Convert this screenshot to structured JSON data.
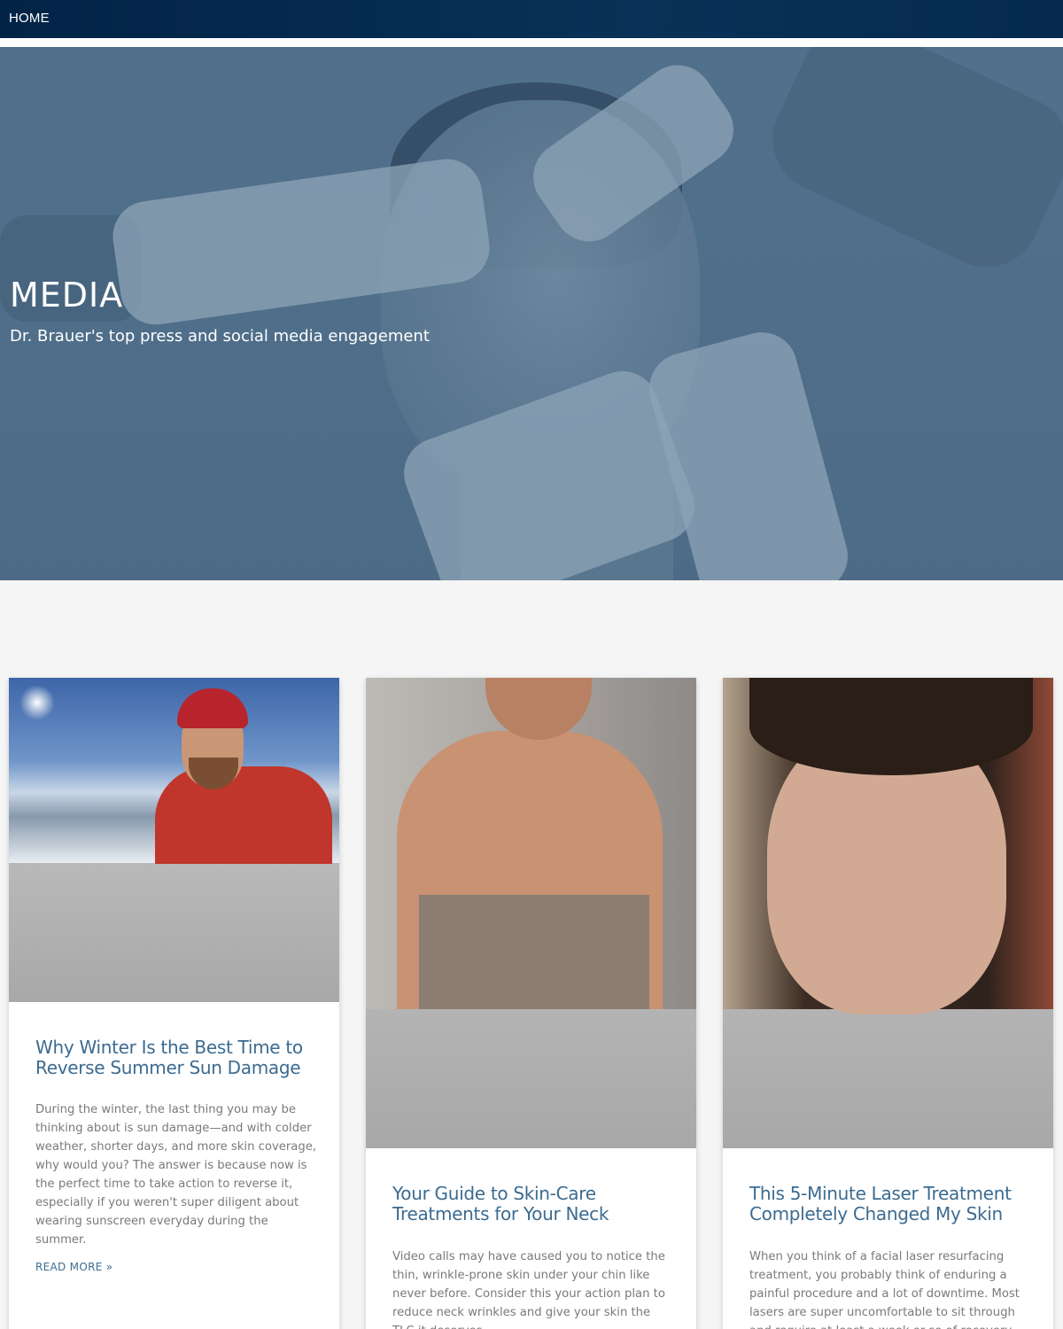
{
  "nav": {
    "home_label": "HOME"
  },
  "hero": {
    "title": "MEDIA",
    "subtitle": "Dr. Brauer's top press and social media engagement"
  },
  "articles": [
    {
      "title": "Why Winter Is the Best Time to Reverse Summer Sun Damage",
      "excerpt": "During the winter, the last thing you may be thinking about is sun damage—and with colder weather, shorter days, and more skin coverage, why would you? The answer is because now is the perfect time to take action to reverse it, especially if you weren't super diligent about wearing sunscreen everyday during the summer.",
      "read_more": "READ MORE »"
    },
    {
      "title": "Your Guide to Skin-Care Treatments for Your Neck",
      "excerpt": "Video calls may have caused you to notice the thin, wrinkle-prone skin under your chin like never before. Consider this your action plan to reduce neck wrinkles and give your skin the TLC it deserves."
    },
    {
      "title": "This 5-Minute Laser Treatment Completely Changed My Skin",
      "excerpt": "When you think of a facial laser resurfacing treatment, you probably think of enduring a painful procedure and a lot of downtime. Most lasers are super uncomfortable to sit through and require at least a week or so of recovery."
    }
  ],
  "colors": {
    "nav_bg": "#012346",
    "link": "#3c6b90",
    "body_text": "#7a7a7a",
    "page_bg": "#f5f5f5"
  }
}
